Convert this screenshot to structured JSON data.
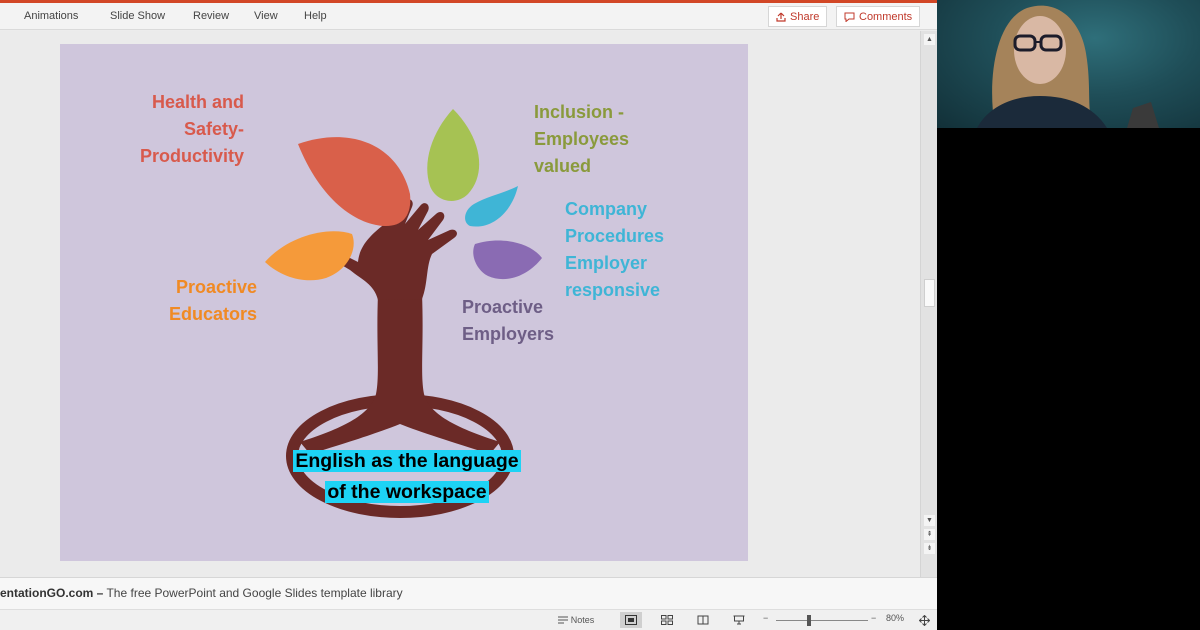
{
  "ribbon": {
    "tabs": [
      "Animations",
      "Slide Show",
      "Review",
      "View",
      "Help"
    ],
    "share_label": "Share",
    "comments_label": "Comments"
  },
  "slide": {
    "labels": {
      "health": [
        "Health and",
        "Safety-",
        "Productivity"
      ],
      "inclusion": [
        "Inclusion -",
        "Employees",
        "valued"
      ],
      "company": [
        "Company",
        "Procedures",
        "Employer",
        "responsive"
      ],
      "educators": [
        "Proactive",
        "Educators"
      ],
      "employers": [
        "Proactive",
        "Employers"
      ],
      "base": [
        "English as the language",
        "of the workspace"
      ]
    },
    "colors": {
      "background": "#cfc6dc",
      "trunk": "#6b2a27",
      "leaf_red": "#d9604a",
      "leaf_green": "#a6c253",
      "leaf_blue": "#3fb5d6",
      "leaf_purple": "#8a6bb3",
      "leaf_orange": "#f59a3a",
      "health_text": "#d85a4c",
      "inclusion_text": "#8a9a3c",
      "company_text": "#3fb5d6",
      "educators_text": "#f08a24",
      "employers_text": "#6e5e86",
      "caption_highlight": "#1dd3f5"
    }
  },
  "notes": {
    "source_bold": "entationGO.com –",
    "source_rest": " The free PowerPoint and Google Slides template library"
  },
  "statusbar": {
    "notes_label": "Notes",
    "zoom_label": "80%"
  }
}
